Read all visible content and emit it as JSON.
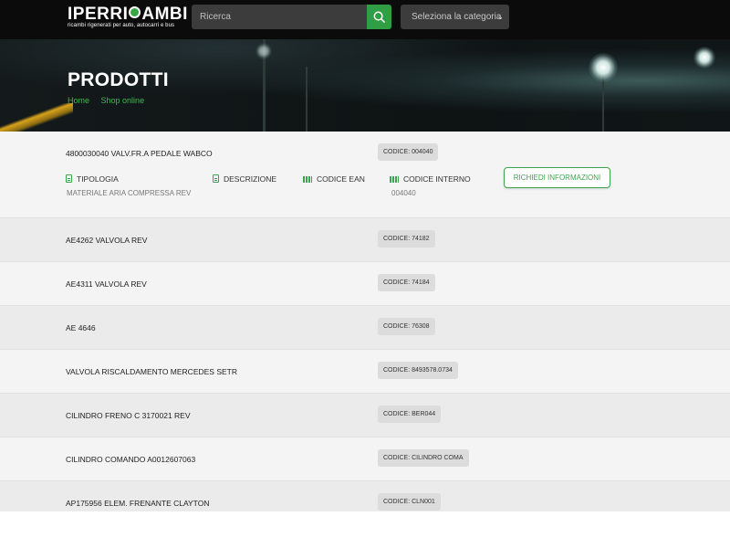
{
  "brand": {
    "name_left": "IPERRI",
    "name_right": "AMBI",
    "tagline": "ricambi rigenerati per auto, autocarri e bus",
    "accent_color": "#35a845"
  },
  "header": {
    "search_placeholder": "Ricerca",
    "search_icon": "search-icon",
    "category_placeholder": "Seleziona la categoria"
  },
  "hero": {
    "title": "PRODOTTI",
    "breadcrumb": [
      "Home",
      "Shop online"
    ]
  },
  "products": [
    {
      "name": "4800030040 VALV.FR.A PEDALE WABCO",
      "code": "CODICE: 004040",
      "expanded": true,
      "details": {
        "tipologia_label": "TIPOLOGIA",
        "tipologia_value": "MATERIALE ARIA COMPRESSA REV",
        "descrizione_label": "DESCRIZIONE",
        "codice_ean_label": "CODICE EAN",
        "codice_interno_label": "CODICE INTERNO",
        "codice_interno_value": "004040",
        "info_button": "RICHIEDI INFORMAZIONI"
      }
    },
    {
      "name": "AE4262 VALVOLA REV",
      "code": "CODICE: 74182"
    },
    {
      "name": "AE4311 VALVOLA REV",
      "code": "CODICE: 74184"
    },
    {
      "name": "AE 4646",
      "code": "CODICE: 76308"
    },
    {
      "name": "VALVOLA RISCALDAMENTO MERCEDES SETR",
      "code": "CODICE: 8493578.0734"
    },
    {
      "name": "CILINDRO FRENO C 3170021 REV",
      "code": "CODICE: BER044"
    },
    {
      "name": "CILINDRO COMANDO A0012607063",
      "code": "CODICE: CILINDRO COMA"
    },
    {
      "name": "AP175956 ELEM. FRENANTE CLAYTON",
      "code": "CODICE: CLN001"
    }
  ]
}
